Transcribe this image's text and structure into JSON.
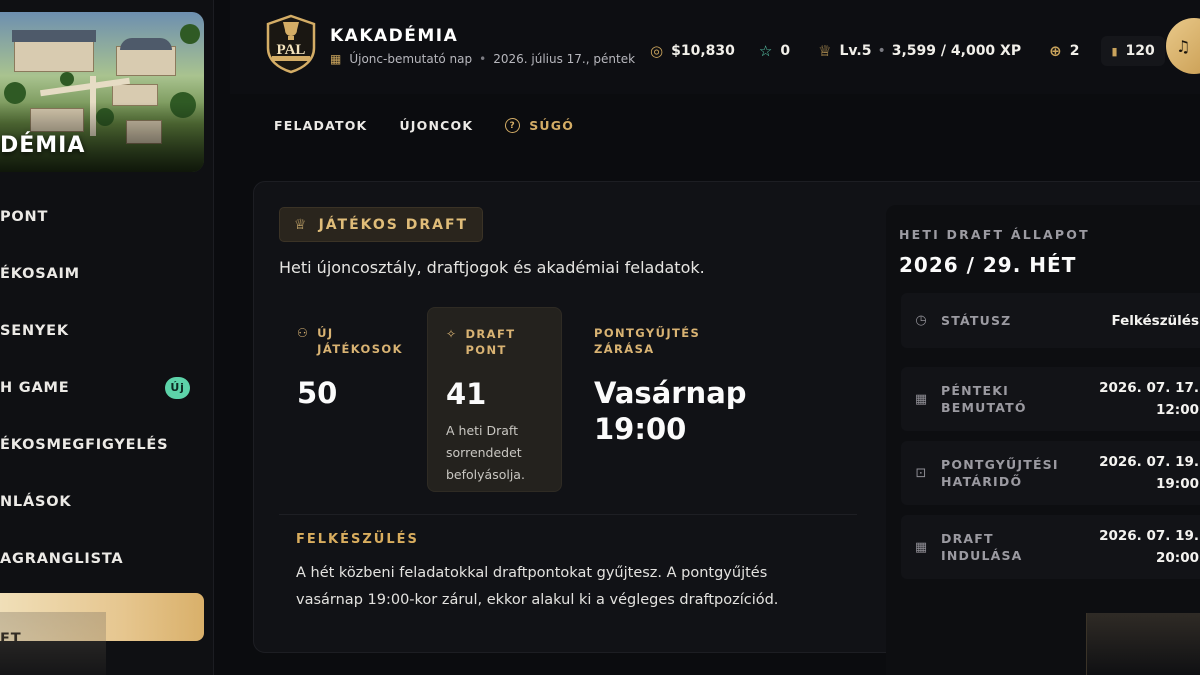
{
  "sidebar": {
    "hero_title": "DÉMIA",
    "items": [
      {
        "label": "PONT"
      },
      {
        "label": "ÉKOSAIM"
      },
      {
        "label": "SENYEK"
      },
      {
        "label": "H GAME",
        "badge": "Új"
      },
      {
        "label": "ÉKOSMEGFIGYELÉS"
      },
      {
        "label": "NLÁSOK"
      },
      {
        "label": "AGRANGLISTA"
      },
      {
        "label": "FT",
        "active": true
      }
    ]
  },
  "header": {
    "logo_text": "PAL",
    "title": "KAKADÉMIA",
    "subtitle_mode": "Újonc-bemutató nap",
    "subtitle_date": "2026. július 17., péntek",
    "cash": "$10,830",
    "stars": "0",
    "level": "Lv.5",
    "xp": "3,599 / 4,000 XP",
    "plus": "2",
    "coins": "120",
    "icons": {
      "cash": "cash-icon",
      "stars": "star-icon",
      "level": "trophy-icon",
      "plus": "plus-circle-icon",
      "coins": "coin-icon"
    },
    "accent_color": "#c9a35c"
  },
  "tabs": [
    {
      "label": "FELADATOK"
    },
    {
      "label": "ÚJONCOK"
    },
    {
      "label": "SÚGÓ"
    }
  ],
  "card": {
    "chip": "JÁTÉKOS DRAFT",
    "description": "Heti újoncosztály, draftjogok és akadémiai feladatok.",
    "kpis": [
      {
        "label": "ÚJ JÁTÉKOSOK",
        "value": "50",
        "note": ""
      },
      {
        "label": "DRAFT PONT",
        "value": "41",
        "note": "A heti Draft sorrendedet befolyásolja."
      },
      {
        "label": "PONTGYŰJTÉS ZÁRÁSA",
        "value": "Vasárnap 19:00",
        "note": ""
      }
    ],
    "prep_title": "FELKÉSZÜLÉS",
    "prep_text": "A hét közbeni feladatokkal draftpontokat gyűjtesz. A pontgyűjtés vasárnap 19:00-kor zárul, ekkor alakul ki a végleges draftpozíciód."
  },
  "panel": {
    "eyebrow": "HETI DRAFT ÁLLAPOT",
    "title": "2026 / 29. HÉT",
    "rows": [
      {
        "label": "STÁTUSZ",
        "value": "Felkészülés"
      },
      {
        "label": "PÉNTEKI BEMUTATÓ",
        "value": "2026. 07. 17.",
        "value2": "12:00"
      },
      {
        "label": "PONTGYŰJTÉSI HATÁRIDŐ",
        "value": "2026. 07. 19.",
        "value2": "19:00"
      },
      {
        "label": "DRAFT INDULÁSA",
        "value": "2026. 07. 19.",
        "value2": "20:00"
      }
    ]
  }
}
